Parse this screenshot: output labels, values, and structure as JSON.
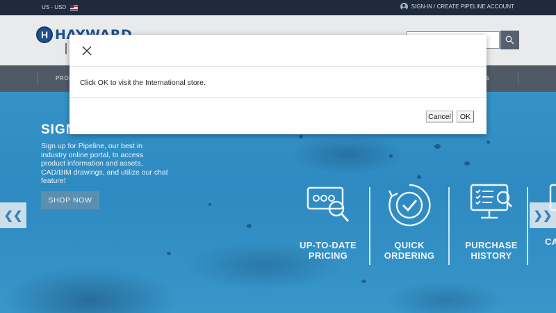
{
  "topbar": {
    "region_label": "US - USD",
    "account_link": "SIGN-IN / CREATE PIPELINE ACCOUNT"
  },
  "header": {
    "logo_text": "HAYWARD",
    "logo_mark": "H",
    "search_placeholder": ""
  },
  "nav": {
    "left_label": "PROD",
    "right_label": "T US"
  },
  "hero": {
    "title": "SIGN",
    "description": "Sign up for Pipeline, our best in industry online portal, to access product information and assets, CAD/BIM drawings, and utilize our chat feature!",
    "cta_label": "SHOP NOW",
    "prev_glyph": "❮❮",
    "next_glyph": "❯❯",
    "features": [
      {
        "label_line1": "UP-TO-DATE",
        "label_line2": "PRICING",
        "icon": "pricing-search-icon"
      },
      {
        "label_line1": "QUICK",
        "label_line2": "ORDERING",
        "icon": "checkmark-refresh-icon"
      },
      {
        "label_line1": "PURCHASE",
        "label_line2": "HISTORY",
        "icon": "monitor-checklist-icon"
      },
      {
        "label_line1": "CA",
        "label_line2": "",
        "icon": "partial-feature-icon"
      }
    ]
  },
  "dialog": {
    "message": "Click OK to visit the International store.",
    "cancel_label": "Cancel",
    "ok_label": "OK"
  },
  "colors": {
    "topbar": "#1f2a3c",
    "nav": "#505a66",
    "brand_blue": "#1d4f8c",
    "hero_blue": "#3593c8"
  }
}
